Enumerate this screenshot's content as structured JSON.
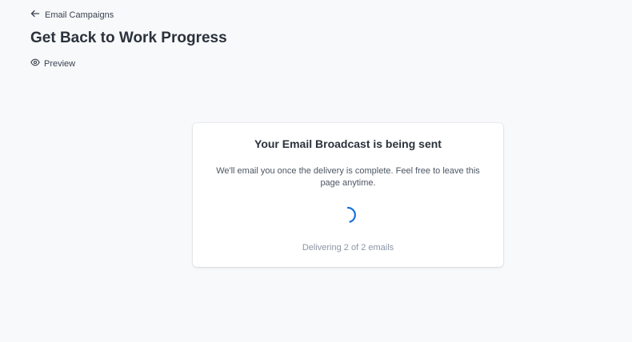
{
  "header": {
    "back_label": "Email Campaigns",
    "title": "Get Back to Work Progress",
    "preview_label": "Preview"
  },
  "status_card": {
    "title": "Your Email Broadcast is being sent",
    "message": "We'll email you once the delivery is complete. Feel free to leave this page anytime.",
    "status": "Delivering 2 of 2 emails"
  },
  "icons": {
    "back": "arrow-left-icon",
    "preview": "eye-icon",
    "spinner": "loading-spinner-icon"
  },
  "colors": {
    "accent": "#1b6fe0",
    "background": "#f8f9fb",
    "muted_text": "#8c95a6"
  }
}
